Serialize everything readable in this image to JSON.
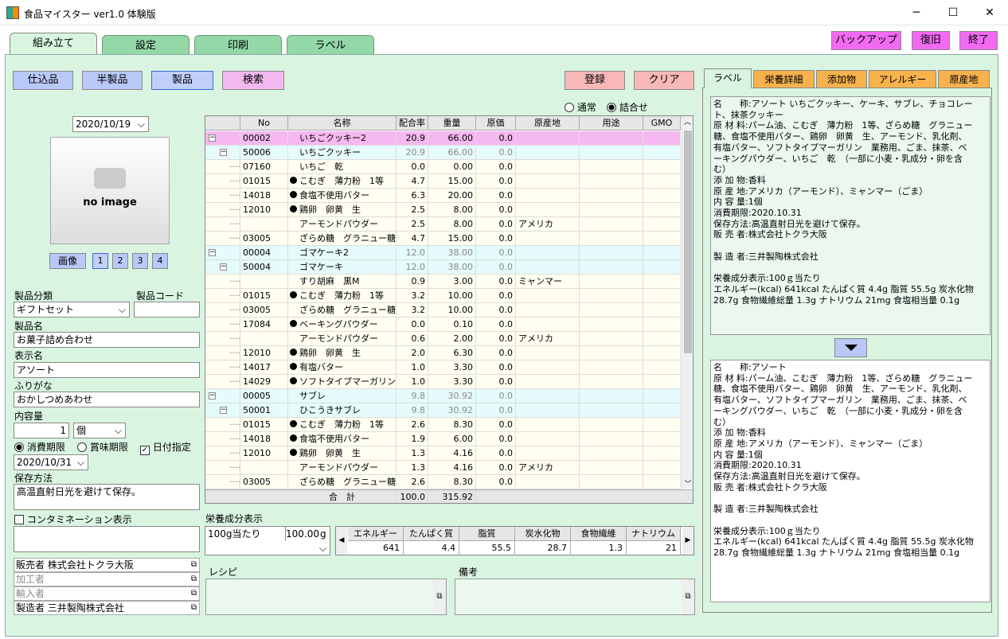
{
  "window": {
    "title": "食品マイスター ver1.0 体験版"
  },
  "main_tabs": [
    "組み立て",
    "設定",
    "印刷",
    "ラベル"
  ],
  "top_buttons": {
    "backup": "バックアップ",
    "restore": "復旧",
    "exit": "終了"
  },
  "mode_buttons": {
    "shikomi": "仕込品",
    "hanseihin": "半製品",
    "seihin": "製品",
    "kensaku": "検索"
  },
  "action_buttons": {
    "register": "登録",
    "clear": "クリア"
  },
  "radio": {
    "normal": "通常",
    "pack": "詰合せ"
  },
  "date_top": "2020/10/19",
  "image": {
    "placeholder": "no image",
    "button": "画像",
    "pages": [
      "1",
      "2",
      "3",
      "4"
    ]
  },
  "product": {
    "category_label": "製品分類",
    "category_value": "ギフトセット",
    "code_label": "製品コード",
    "code_value": "",
    "name_label": "製品名",
    "name_value": "お菓子詰め合わせ",
    "display_label": "表示名",
    "display_value": "アソート",
    "furigana_label": "ふりがな",
    "furigana_value": "おかしつめあわせ",
    "content_label": "内容量",
    "content_qty": "1",
    "content_unit": "個",
    "expiry_use": "消費期限",
    "expiry_best": "賞味期限",
    "date_specify": "日付指定",
    "expiry_date": "2020/10/31",
    "storage_label": "保存方法",
    "storage_value": "高温直射日光を避けて保存。",
    "contam_label": "コンタミネーション表示",
    "seller": "販売者 株式会社トクラ大阪",
    "processor": "加工者",
    "importer": "輸入者",
    "maker": "製造者 三井製陶株式会社"
  },
  "grid": {
    "headers": [
      "No",
      "名称",
      "配合率",
      "重量",
      "原価",
      "原産地",
      "用途",
      "GMO"
    ],
    "rows": [
      {
        "lvl": 0,
        "no": "00002",
        "dot": false,
        "name": "いちごクッキー2",
        "rate": "20.9",
        "weight": "66.00",
        "cost": "0.0",
        "origin": "",
        "type": "top"
      },
      {
        "lvl": 1,
        "no": "50006",
        "dot": false,
        "name": "いちごクッキー",
        "rate": "20.9",
        "weight": "66.00",
        "cost": "0.0",
        "origin": "",
        "type": "sub"
      },
      {
        "lvl": 2,
        "no": "07160",
        "dot": false,
        "name": "いちご　乾",
        "rate": "0.0",
        "weight": "0.00",
        "cost": "0.0",
        "origin": "",
        "type": "leaf"
      },
      {
        "lvl": 2,
        "no": "01015",
        "dot": true,
        "name": "こむぎ　薄力粉　1等",
        "rate": "4.7",
        "weight": "15.00",
        "cost": "0.0",
        "origin": "",
        "type": "leaf"
      },
      {
        "lvl": 2,
        "no": "14018",
        "dot": true,
        "name": "食塩不使用バター",
        "rate": "6.3",
        "weight": "20.00",
        "cost": "0.0",
        "origin": "",
        "type": "leaf"
      },
      {
        "lvl": 2,
        "no": "12010",
        "dot": true,
        "name": "鶏卵　卵黄　生",
        "rate": "2.5",
        "weight": "8.00",
        "cost": "0.0",
        "origin": "",
        "type": "leaf"
      },
      {
        "lvl": 2,
        "no": "",
        "dot": false,
        "name": "アーモンドパウダー",
        "rate": "2.5",
        "weight": "8.00",
        "cost": "0.0",
        "origin": "アメリカ",
        "type": "leaf"
      },
      {
        "lvl": 2,
        "no": "03005",
        "dot": false,
        "name": "ざらめ糖　グラニュー糖",
        "rate": "4.7",
        "weight": "15.00",
        "cost": "0.0",
        "origin": "",
        "type": "leaf"
      },
      {
        "lvl": 0,
        "no": "00004",
        "dot": false,
        "name": "ゴマケーキ2",
        "rate": "12.0",
        "weight": "38.00",
        "cost": "0.0",
        "origin": "",
        "type": "sub"
      },
      {
        "lvl": 1,
        "no": "50004",
        "dot": false,
        "name": "ゴマケーキ",
        "rate": "12.0",
        "weight": "38.00",
        "cost": "0.0",
        "origin": "",
        "type": "sub"
      },
      {
        "lvl": 2,
        "no": "",
        "dot": false,
        "name": "すり胡麻　黒M",
        "rate": "0.9",
        "weight": "3.00",
        "cost": "0.0",
        "origin": "ミャンマー",
        "type": "leaf"
      },
      {
        "lvl": 2,
        "no": "01015",
        "dot": true,
        "name": "こむぎ　薄力粉　1等",
        "rate": "3.2",
        "weight": "10.00",
        "cost": "0.0",
        "origin": "",
        "type": "leaf"
      },
      {
        "lvl": 2,
        "no": "03005",
        "dot": false,
        "name": "ざらめ糖　グラニュー糖",
        "rate": "3.2",
        "weight": "10.00",
        "cost": "0.0",
        "origin": "",
        "type": "leaf"
      },
      {
        "lvl": 2,
        "no": "17084",
        "dot": true,
        "name": "ベーキングパウダー",
        "rate": "0.0",
        "weight": "0.10",
        "cost": "0.0",
        "origin": "",
        "type": "leaf"
      },
      {
        "lvl": 2,
        "no": "",
        "dot": false,
        "name": "アーモンドパウダー",
        "rate": "0.6",
        "weight": "2.00",
        "cost": "0.0",
        "origin": "アメリカ",
        "type": "leaf"
      },
      {
        "lvl": 2,
        "no": "12010",
        "dot": true,
        "name": "鶏卵　卵黄　生",
        "rate": "2.0",
        "weight": "6.30",
        "cost": "0.0",
        "origin": "",
        "type": "leaf"
      },
      {
        "lvl": 2,
        "no": "14017",
        "dot": true,
        "name": "有塩バター",
        "rate": "1.0",
        "weight": "3.30",
        "cost": "0.0",
        "origin": "",
        "type": "leaf"
      },
      {
        "lvl": 2,
        "no": "14029",
        "dot": true,
        "name": "ソフトタイプマーガリン　業",
        "rate": "1.0",
        "weight": "3.30",
        "cost": "0.0",
        "origin": "",
        "type": "leaf"
      },
      {
        "lvl": 0,
        "no": "00005",
        "dot": false,
        "name": "サブレ",
        "rate": "9.8",
        "weight": "30.92",
        "cost": "0.0",
        "origin": "",
        "type": "sub"
      },
      {
        "lvl": 1,
        "no": "50001",
        "dot": false,
        "name": "ひこうきサブレ",
        "rate": "9.8",
        "weight": "30.92",
        "cost": "0.0",
        "origin": "",
        "type": "sub"
      },
      {
        "lvl": 2,
        "no": "01015",
        "dot": true,
        "name": "こむぎ　薄力粉　1等",
        "rate": "2.6",
        "weight": "8.30",
        "cost": "0.0",
        "origin": "",
        "type": "leaf"
      },
      {
        "lvl": 2,
        "no": "14018",
        "dot": true,
        "name": "食塩不使用バター",
        "rate": "1.9",
        "weight": "6.00",
        "cost": "0.0",
        "origin": "",
        "type": "leaf"
      },
      {
        "lvl": 2,
        "no": "12010",
        "dot": true,
        "name": "鶏卵　卵黄　生",
        "rate": "1.3",
        "weight": "4.16",
        "cost": "0.0",
        "origin": "",
        "type": "leaf"
      },
      {
        "lvl": 2,
        "no": "",
        "dot": false,
        "name": "アーモンドパウダー",
        "rate": "1.3",
        "weight": "4.16",
        "cost": "0.0",
        "origin": "アメリカ",
        "type": "leaf"
      },
      {
        "lvl": 2,
        "no": "03005",
        "dot": false,
        "name": "ざらめ糖　グラニュー糖",
        "rate": "2.6",
        "weight": "8.30",
        "cost": "0.0",
        "origin": "",
        "type": "leaf"
      }
    ],
    "total_label": "合　計",
    "total_rate": "100.0",
    "total_weight": "315.92"
  },
  "nutrition": {
    "label": "栄養成分表示",
    "per": "100g当たり",
    "amount": "100.00",
    "unit": "g",
    "headers": [
      "エネルギー",
      "たんぱく質",
      "脂質",
      "炭水化物",
      "食物繊維",
      "ナトリウム"
    ],
    "values": [
      "641",
      "4.4",
      "55.5",
      "28.7",
      "1.3",
      "21"
    ]
  },
  "recipe_label": "レシピ",
  "notes_label": "備考",
  "right_tabs": [
    "ラベル",
    "栄養詳細",
    "添加物",
    "アレルギー",
    "原産地"
  ],
  "label_text_1": "名　　称:アソート いちごクッキー、ケーキ、サブレ、チョコレート、抹茶クッキー\n原 材 料:パーム油、こむぎ　薄力粉　1等、ざらめ糖　グラニュー糖、食塩不使用バター、鶏卵　卵黄　生、アーモンド、乳化剤、有塩バター、ソフトタイプマーガリン　業務用、ごま、抹茶、ベーキングパウダー、いちご　乾　（一部に小麦・乳成分・卵を含む）\n添 加 物:香料\n原 産 地:アメリカ（アーモンド）、ミャンマー（ごま）\n内 容 量:1個\n消費期限:2020.10.31\n保存方法:高温直射日光を避けて保存。\n販 売 者:株式会社トクラ大阪\n\n製 造 者:三井製陶株式会社\n\n栄養成分表示:100ｇ当たり\nエネルギー(kcal) 641kcal たんぱく質 4.4g 脂質 55.5g 炭水化物 28.7g 食物繊維総量 1.3g ナトリウム 21mg 食塩相当量 0.1g",
  "label_text_2": "名　　称:アソート\n原 材 料:パーム油、こむぎ　薄力粉　1等、ざらめ糖　グラニュー糖、食塩不使用バター、鶏卵　卵黄　生、アーモンド、乳化剤、有塩バター、ソフトタイプマーガリン　業務用、ごま、抹茶、ベーキングパウダー、いちご　乾　（一部に小麦・乳成分・卵を含む）\n添 加 物:香料\n原 産 地:アメリカ（アーモンド）、ミャンマー（ごま）\n内 容 量:1個\n消費期限:2020.10.31\n保存方法:高温直射日光を避けて保存。\n販 売 者:株式会社トクラ大阪\n\n製 造 者:三井製陶株式会社\n\n栄養成分表示:100ｇ当たり\nエネルギー(kcal) 641kcal たんぱく質 4.4g 脂質 55.5g 炭水化物 28.7g 食物繊維総量 1.3g ナトリウム 21mg 食塩相当量 0.1g"
}
